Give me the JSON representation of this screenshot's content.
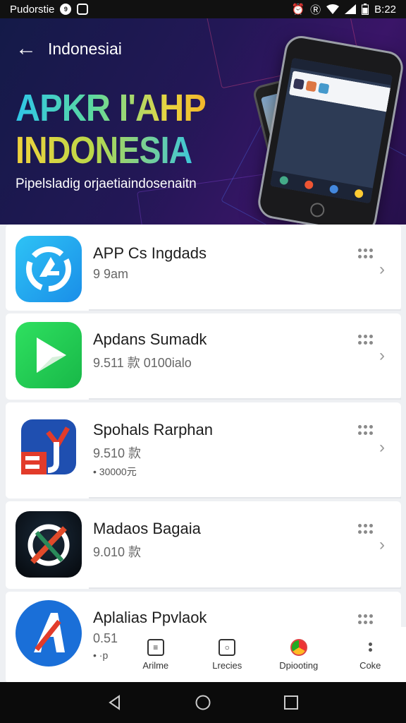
{
  "status_bar": {
    "carrier": "Pudorstie",
    "time": "B:22",
    "icons": [
      "notification-icon",
      "image-icon",
      "alarm-icon",
      "data-icon",
      "wifi-icon",
      "signal-icon",
      "battery-icon"
    ]
  },
  "header": {
    "title": "Indonesiai"
  },
  "hero": {
    "headline_line1": "APKR I'AHP",
    "headline_line2": "INDONESIA",
    "subtitle": "Pipelsladig orjaetiaindosenaitn",
    "colors": {
      "bg_start": "#141a48",
      "bg_end": "#3a1568",
      "title_cyan": "#2fc6e8",
      "title_yellow": "#f0d23c"
    }
  },
  "apps": [
    {
      "name": "APP Cs Ingdads",
      "meta": "9 9am",
      "meta2": ""
    },
    {
      "name": "Apdans Sumadk",
      "meta": "9.511 款 0100ialo",
      "meta2": ""
    },
    {
      "name": "Spohals Rarphan",
      "meta": "9.510 款",
      "meta2": "• 30000元"
    },
    {
      "name": "Madaos Bagaia",
      "meta": "9.010 款",
      "meta2": ""
    },
    {
      "name": "Aplalias Ppvlaok",
      "meta": "0.51",
      "meta2": "• ·р"
    }
  ],
  "bottom_nav": {
    "items": [
      {
        "label": "Arilme",
        "icon": "list-icon"
      },
      {
        "label": "Lrecies",
        "icon": "record-icon"
      },
      {
        "label": "Dpiooting",
        "icon": "chrome-icon"
      },
      {
        "label": "Coke",
        "icon": "more-icon"
      }
    ]
  }
}
